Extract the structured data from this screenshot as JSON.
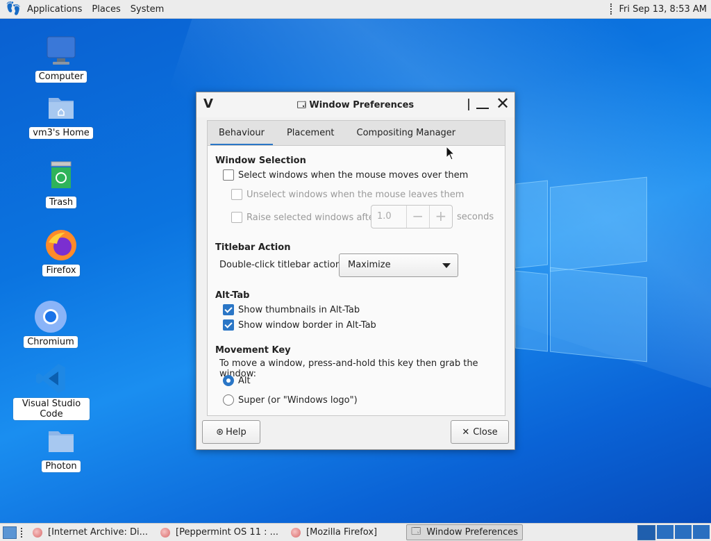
{
  "top_panel": {
    "menus": [
      "Applications",
      "Places",
      "System"
    ],
    "clock": "Fri Sep 13,  8:53 AM"
  },
  "desktop_icons": [
    {
      "label": "Computer",
      "icon": "computer-icon"
    },
    {
      "label": "vm3's Home",
      "icon": "home-folder-icon"
    },
    {
      "label": "Trash",
      "icon": "trash-icon"
    },
    {
      "label": "Firefox",
      "icon": "firefox-icon"
    },
    {
      "label": "Chromium",
      "icon": "chromium-icon"
    },
    {
      "label": "Visual Studio Code",
      "icon": "vscode-icon"
    },
    {
      "label": "Photon",
      "icon": "folder-icon"
    }
  ],
  "dialog": {
    "title": "Window Preferences",
    "tabs": [
      "Behaviour",
      "Placement",
      "Compositing Manager"
    ],
    "active_tab": "Behaviour",
    "window_selection": {
      "heading": "Window Selection",
      "select_on_hover": {
        "label": "Select windows when the mouse moves over them",
        "checked": false
      },
      "unselect_on_leave": {
        "label": "Unselect windows when the mouse leaves them",
        "checked": false,
        "disabled": true
      },
      "raise_after": {
        "label": "Raise selected windows after",
        "checked": false,
        "disabled": true,
        "value": "1.0",
        "unit": "seconds"
      }
    },
    "titlebar_action": {
      "heading": "Titlebar Action",
      "label": "Double-click titlebar action:",
      "value": "Maximize"
    },
    "alt_tab": {
      "heading": "Alt-Tab",
      "thumbnails": {
        "label": "Show thumbnails in Alt-Tab",
        "checked": true
      },
      "border": {
        "label": "Show window border in Alt-Tab",
        "checked": true
      }
    },
    "movement_key": {
      "heading": "Movement Key",
      "description": "To move a window, press-and-hold this key then grab the window:",
      "options": [
        {
          "label": "Alt",
          "selected": true
        },
        {
          "label": "Super (or \"Windows logo\")",
          "selected": false
        }
      ]
    },
    "help_label": "Help",
    "close_label": "Close"
  },
  "taskbar": {
    "tasks": [
      {
        "label": "[Internet Archive: Di...",
        "active": false
      },
      {
        "label": "[Peppermint OS 11 : ...",
        "active": false
      },
      {
        "label": "[Mozilla Firefox]",
        "active": false
      },
      {
        "label": "Window Preferences",
        "active": true
      }
    ]
  }
}
